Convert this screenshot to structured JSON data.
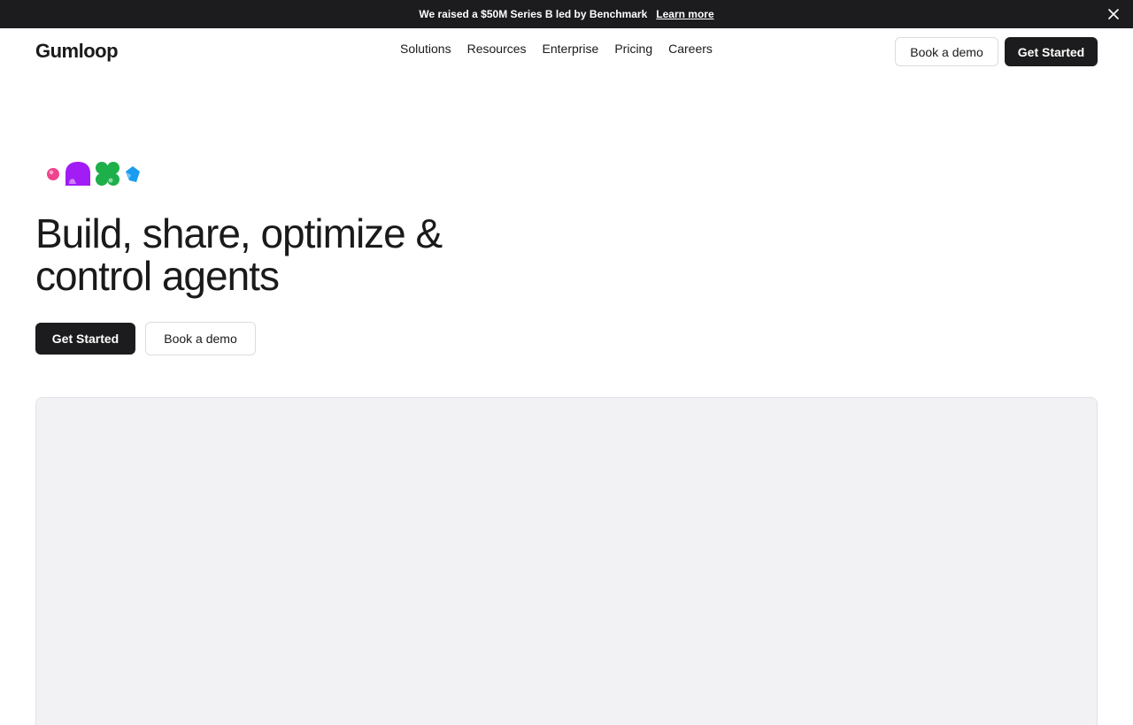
{
  "announcement": {
    "message": "We raised a $50M Series B led by Benchmark",
    "link_label": "Learn more"
  },
  "header": {
    "logo": "Gumloop",
    "menu": [
      "Solutions",
      "Resources",
      "Enterprise",
      "Pricing",
      "Careers"
    ],
    "book_demo_label": "Book a demo",
    "get_started_label": "Get Started"
  },
  "hero": {
    "headline_line1": "Build, share, optimize &",
    "headline_line2": "control agents",
    "get_started_label": "Get Started",
    "book_demo_label": "Book a demo",
    "blob_colors": [
      "#f0448f",
      "#a21cf5",
      "#1db04a",
      "#1a9cf0"
    ]
  },
  "icons": {
    "close": "close-icon",
    "blobs": [
      "pink-dot-icon",
      "purple-blob-icon",
      "green-clover-icon",
      "blue-gem-icon"
    ]
  },
  "colors": {
    "dark": "#1c1c1e",
    "media_bg": "#f2f2f4"
  }
}
